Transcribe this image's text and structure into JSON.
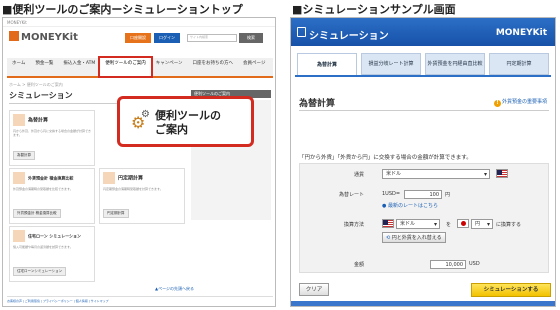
{
  "captions": {
    "left": "■便利ツールのご案内ーシミュレーショントップ",
    "right": "■シミュレーションサンプル画面"
  },
  "left_panel": {
    "logo": "MONEYKit",
    "open_account": "口座開設",
    "login": "ログイン",
    "search_placeholder": "サイト内検索",
    "search_button": "検索",
    "nav": [
      "ホーム",
      "預金一覧",
      "振込入金・ATM",
      "便利ツールのご案内",
      "キャンペーン",
      "口座をお持ちの方へ",
      "会員ページ"
    ],
    "breadcrumb": "ホーム > 便利ツールのご案内",
    "page_title": "シミュレーション",
    "sidebar_box": "便利ツールのご案内",
    "cards": [
      {
        "title": "為替計算",
        "desc": "円から外貨、外貨から円に交換する場合の金額が計算できます。",
        "button": "為替計算"
      },
      {
        "title": "外貨預金計 積金換算比較",
        "desc": "外貨預金の満期時の受取額を比較できます。",
        "button": "外貨預金計 積金換算比較"
      },
      {
        "title": "円定期計算",
        "desc": "円定期預金の満期時受取額を計算できます。",
        "button": "円定期計算"
      },
      {
        "title": "住宅ローン シミュレーション",
        "desc": "借入可能額や毎月の返済額を試算できます。",
        "button": "住宅ローンシミュレーション"
      }
    ],
    "page_top": "▲ページの先頭へ戻る",
    "footer_links": "お客様の声 | ご利用環境 | プライバシーポリシー | 個人情報 | サイトマップ",
    "callout_line1": "便利ツールの",
    "callout_line2": "ご案内"
  },
  "right_panel": {
    "title": "シミュレーション",
    "brand": "MONEYKit",
    "tabs": [
      "為替計算",
      "損益分岐レート計算",
      "外貨預金を円経由直比較",
      "円定期計算"
    ],
    "section_title": "為替計算",
    "notice": "外貨預金の重要事項",
    "description": "「円から外貨」「外貨から円」に交換する場合の金額が計算できます。",
    "currency_label": "通貨",
    "currency_value": "米ドル",
    "rate_label": "為替レート",
    "rate_prefix": "1USD=",
    "rate_value": "100",
    "rate_unit": "円",
    "rate_link": "最新のレートはこちら",
    "method_label": "換算方法",
    "method_from": "米ドル",
    "method_mid": "を",
    "method_to": "円",
    "method_suffix": "に換算する",
    "swap_button": "円と外貨を入れ替える",
    "amount_label": "金額",
    "amount_value": "10,000",
    "amount_unit": "USD",
    "clear_button": "クリア",
    "run_button": "シミュレーションする"
  }
}
